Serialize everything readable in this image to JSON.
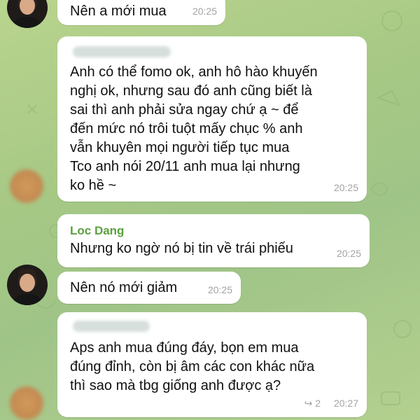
{
  "messages": [
    {
      "text": "Nên a mới mua",
      "time": "20:25"
    },
    {
      "lines": [
        "Anh có thể fomo ok, anh hô hào khuyến",
        "nghị ok, nhưng sau đó anh cũng biết là",
        "sai thì anh phải sửa ngay chứ ạ ~ để",
        "đến mức nó trôi tuột mấy chục % anh",
        "vẫn khuyên mọi người tiếp tục mua",
        "Tco anh nói 20/11 anh mua lại nhưng",
        "ko hề ~"
      ],
      "time": "20:25"
    },
    {
      "sender": "Loc Dang",
      "text": "Nhưng ko ngờ nó bị tin về trái phiếu",
      "time": "20:25"
    },
    {
      "text": "Nên nó mới giảm",
      "time": "20:25"
    },
    {
      "lines": [
        "Aps anh mua đúng đáy, bọn em mua",
        "đúng đỉnh, còn bị âm các con khác nữa",
        "thì sao mà tbg giống anh được ạ?"
      ],
      "time": "20:27",
      "reply_count": "2"
    }
  ],
  "colors": {
    "sender_name": "#5aa03f",
    "bubble": "#ffffff",
    "time": "#a3a3a3"
  },
  "icons": {
    "reply": "reply-arrow-icon"
  }
}
